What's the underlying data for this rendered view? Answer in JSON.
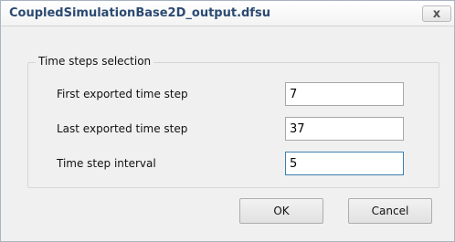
{
  "window": {
    "title": "CoupledSimulationBase2D_output.dfsu",
    "close_glyph": "x"
  },
  "group": {
    "legend": "Time steps selection",
    "fields": [
      {
        "label": "First exported time step",
        "value": "7"
      },
      {
        "label": "Last exported time step",
        "value": "37"
      },
      {
        "label": "Time step interval",
        "value": "5"
      }
    ]
  },
  "buttons": {
    "ok_label": "OK",
    "cancel_label": "Cancel"
  },
  "colors": {
    "title_text": "#2b4a72",
    "focus_border": "#3c7fb1",
    "dialog_bg": "#f0f0f0"
  },
  "icons": {
    "close": "close-icon"
  }
}
